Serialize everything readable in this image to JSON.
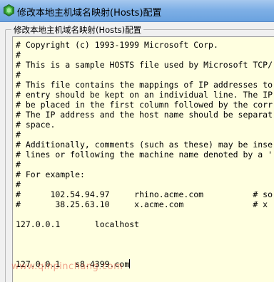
{
  "window": {
    "title": "修改本地主机域名映射(Hosts)配置",
    "icon": "green-hexagon-app-icon",
    "colors": {
      "titlebar": "#7fb0e6",
      "editor_background": "#ffffe0",
      "icon_green": "#3aa33a"
    }
  },
  "group": {
    "label": "修改本地主机域名映射(Hosts)配置"
  },
  "editor": {
    "lines": [
      "# Copyright (c) 1993-1999 Microsoft Corp.",
      "#",
      "# This is a sample HOSTS file used by Microsoft TCP/",
      "#",
      "# This file contains the mappings of IP addresses to",
      "# entry should be kept on an individual line. The IP",
      "# be placed in the first column followed by the corr",
      "# The IP address and the host name should be separat",
      "# space.",
      "#",
      "# Additionally, comments (such as these) may be inse",
      "# lines or following the machine name denoted by a '",
      "#",
      "# For example:",
      "#",
      "#      102.54.94.97     rhino.acme.com          # so",
      "#       38.25.63.10     x.acme.com              # x",
      "",
      "127.0.0.1       localhost",
      "",
      "",
      "",
      "127.0.0.1   s8.4399.com"
    ]
  },
  "watermark": {
    "text": "www.qinpinchang.com"
  }
}
